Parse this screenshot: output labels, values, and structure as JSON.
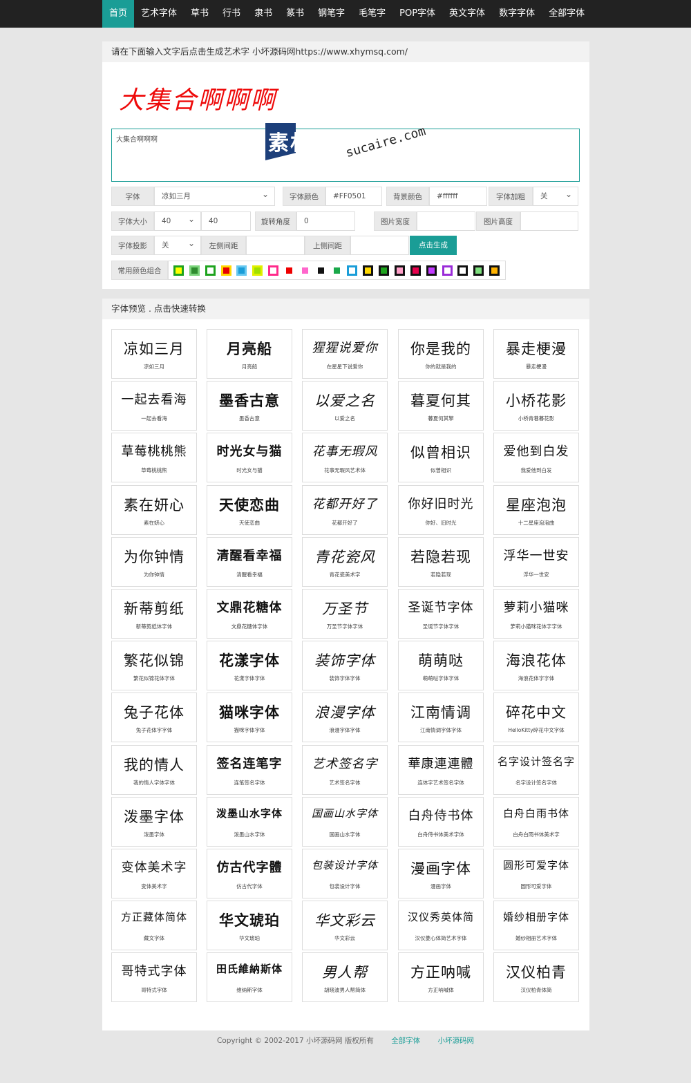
{
  "nav": {
    "items": [
      "首页",
      "艺术字体",
      "草书",
      "行书",
      "隶书",
      "篆书",
      "钢笔字",
      "毛笔字",
      "POP字体",
      "英文字体",
      "数字字体",
      "全部字体"
    ],
    "active_index": 0,
    "colors": {
      "bar": "#222222",
      "active": "#1a9d96"
    }
  },
  "generator": {
    "heading": "请在下面输入文字后点击生成艺术字 小坏源码网https://www.xhymsq.com/",
    "preview_text": "大集合啊啊啊",
    "preview_color": "#ee0a0a",
    "textarea_value": "大集合啊啊啊",
    "watermark": {
      "cn": "素材熱",
      "en": "sucaire.com"
    },
    "fields": {
      "font_label": "字体",
      "font_value": "凉如三月",
      "font_color_label": "字体颜色",
      "font_color_value": "#FF0501",
      "bg_color_label": "背景颜色",
      "bg_color_value": "#ffffff",
      "bold_label": "字体加粗",
      "bold_value": "关",
      "size_label": "字体大小",
      "size_select_value": "40",
      "size_input_value": "40",
      "rotate_label": "旋转角度",
      "rotate_value": "0",
      "img_width_label": "图片宽度",
      "img_width_value": "",
      "img_height_label": "图片高度",
      "img_height_value": "",
      "shadow_label": "字体投影",
      "shadow_value": "关",
      "left_margin_label": "左侧间距",
      "left_margin_value": "",
      "top_margin_label": "上侧间距",
      "top_margin_value": "",
      "generate_button": "点击生成",
      "palette_label": "常用颜色组合"
    },
    "palette": [
      {
        "outer": "#1ea31e",
        "inner": "#ffff00"
      },
      {
        "outer": "#7ad37a",
        "inner": "#2e8b2e"
      },
      {
        "outer": "#1ea31e",
        "inner": "#ffffff"
      },
      {
        "outer": "#ffd800",
        "inner": "#e60000"
      },
      {
        "outer": "#67c8f0",
        "inner": "#1a9dd8"
      },
      {
        "outer": "#e0f000",
        "inner": "#a0e000"
      },
      {
        "outer": "#ff2a8a",
        "inner": "#ffffff"
      },
      {
        "outer": "#ffffff",
        "inner": "#ee0000"
      },
      {
        "outer": "#ffffff",
        "inner": "#ff66cc"
      },
      {
        "outer": "#ffffff",
        "inner": "#111111"
      },
      {
        "outer": "#ffffff",
        "inner": "#1aa84a"
      },
      {
        "outer": "#1a9dd8",
        "inner": "#ffffff"
      },
      {
        "outer": "#111111",
        "inner": "#ffd800"
      },
      {
        "outer": "#111111",
        "inner": "#1ea31e"
      },
      {
        "outer": "#111111",
        "inner": "#ff9fc8"
      },
      {
        "outer": "#111111",
        "inner": "#e6004c"
      },
      {
        "outer": "#111111",
        "inner": "#c23aff"
      },
      {
        "outer": "#9a2bd8",
        "inner": "#ffffff"
      },
      {
        "outer": "#111111",
        "inner": "#ffffff"
      },
      {
        "outer": "#111111",
        "inner": "#7ee07e"
      },
      {
        "outer": "#111111",
        "inner": "#ffb300"
      }
    ]
  },
  "fonts_panel": {
    "heading": "字体预览 . 点击快速转换",
    "cards": [
      {
        "art": "凉如三月",
        "caption": "凉如三月"
      },
      {
        "art": "月亮船",
        "caption": "月亮船"
      },
      {
        "art": "猩猩说爱你",
        "caption": "在星星下说爱你"
      },
      {
        "art": "你是我的",
        "caption": "你的就是我的"
      },
      {
        "art": "暴走梗漫",
        "caption": "暴走梗漫"
      },
      {
        "art": "一起去看海",
        "caption": "一起去看海"
      },
      {
        "art": "墨香古意",
        "caption": "墨香古意"
      },
      {
        "art": "以爱之名",
        "caption": "以爱之名"
      },
      {
        "art": "暮夏何其",
        "caption": "暮夏何其擎"
      },
      {
        "art": "小桥花影",
        "caption": "小桥青巷暮花影"
      },
      {
        "art": "草莓桃桃熊",
        "caption": "草莓桃桃熊"
      },
      {
        "art": "时光女与猫",
        "caption": "时光女与猫"
      },
      {
        "art": "花事无瑕风",
        "caption": "花事无瑕风艺术体"
      },
      {
        "art": "似曾相识",
        "caption": "似曾相识"
      },
      {
        "art": "爱他到白发",
        "caption": "我爱他到白发"
      },
      {
        "art": "素在妍心",
        "caption": "素在妍心"
      },
      {
        "art": "天使恋曲",
        "caption": "天使恋曲"
      },
      {
        "art": "花都开好了",
        "caption": "花都开好了"
      },
      {
        "art": "你好旧时光",
        "caption": "你好、旧时光"
      },
      {
        "art": "星座泡泡",
        "caption": "十二星座泡泡曲"
      },
      {
        "art": "为你钟情",
        "caption": "为你钟情"
      },
      {
        "art": "清醒看幸福",
        "caption": "清醒看幸福"
      },
      {
        "art": "青花瓷风",
        "caption": "青花瓷美术字"
      },
      {
        "art": "若隐若现",
        "caption": "若隐若现"
      },
      {
        "art": "浮华一世安",
        "caption": "浮华一世安"
      },
      {
        "art": "新蒂剪纸",
        "caption": "新蒂剪纸体字体"
      },
      {
        "art": "文鼎花糖体",
        "caption": "文鼎花糖体字体"
      },
      {
        "art": "万圣节",
        "caption": "万圣节字体字体"
      },
      {
        "art": "圣诞节字体",
        "caption": "圣诞节字体字体"
      },
      {
        "art": "萝莉小猫咪",
        "caption": "萝莉小猫咪花体字字体"
      },
      {
        "art": "繁花似锦",
        "caption": "繁花似锦花体字体"
      },
      {
        "art": "花漾字体",
        "caption": "花漾字体字体"
      },
      {
        "art": "装饰字体",
        "caption": "装饰字体字体"
      },
      {
        "art": "萌萌哒",
        "caption": "萌萌哒字体字体"
      },
      {
        "art": "海浪花体",
        "caption": "海浪花体字字体"
      },
      {
        "art": "兔子花体",
        "caption": "兔子花体字字体"
      },
      {
        "art": "猫咪字体",
        "caption": "猫咪字体字体"
      },
      {
        "art": "浪漫字体",
        "caption": "浪漫字体字体"
      },
      {
        "art": "江南情调",
        "caption": "江南情调字体字体"
      },
      {
        "art": "碎花中文",
        "caption": "HelloKitty碎花中文字体"
      },
      {
        "art": "我的情人",
        "caption": "我的情人字体字体"
      },
      {
        "art": "签名连笔字",
        "caption": "连笔签名字体"
      },
      {
        "art": "艺术签名字",
        "caption": "艺术签名字体"
      },
      {
        "art": "華康連連體",
        "caption": "连体字艺术签名字体"
      },
      {
        "art": "名字设计签名字",
        "caption": "名字设计签名字体"
      },
      {
        "art": "泼墨字体",
        "caption": "泼墨字体"
      },
      {
        "art": "泼墨山水字体",
        "caption": "泼墨山水字体"
      },
      {
        "art": "国画山水字体",
        "caption": "国画山水字体"
      },
      {
        "art": "白舟侍书体",
        "caption": "白舟侍书体美术字体"
      },
      {
        "art": "白舟白雨书体",
        "caption": "白舟白雨书体美术字"
      },
      {
        "art": "变体美术字",
        "caption": "变体美术字"
      },
      {
        "art": "仿古代字體",
        "caption": "仿古代字体"
      },
      {
        "art": "包装设计字体",
        "caption": "包装设计字体"
      },
      {
        "art": "漫画字体",
        "caption": "漫画字体"
      },
      {
        "art": "圆形可爱字体",
        "caption": "圆形可爱字体"
      },
      {
        "art": "方正藏体简体",
        "caption": "藏文字体"
      },
      {
        "art": "华文琥珀",
        "caption": "华文琥珀"
      },
      {
        "art": "华文彩云",
        "caption": "华文彩云"
      },
      {
        "art": "汉仪秀英体简",
        "caption": "汉仪菱心体简艺术字体"
      },
      {
        "art": "婚纱相册字体",
        "caption": "婚纱相册艺术字体"
      },
      {
        "art": "哥特式字体",
        "caption": "哥特式字体"
      },
      {
        "art": "田氏維納斯体",
        "caption": "维纳斯字体"
      },
      {
        "art": "男人帮",
        "caption": "胡晓波男人帮简体"
      },
      {
        "art": "方正呐喊",
        "caption": "方正呐喊体"
      },
      {
        "art": "汉仪柏青",
        "caption": "汉仪柏青体简"
      }
    ]
  },
  "footer": {
    "copyright": "Copyright © 2002-2017 小坏源码网 版权所有",
    "link1": "全部字体",
    "link2": "小坏源码网"
  }
}
